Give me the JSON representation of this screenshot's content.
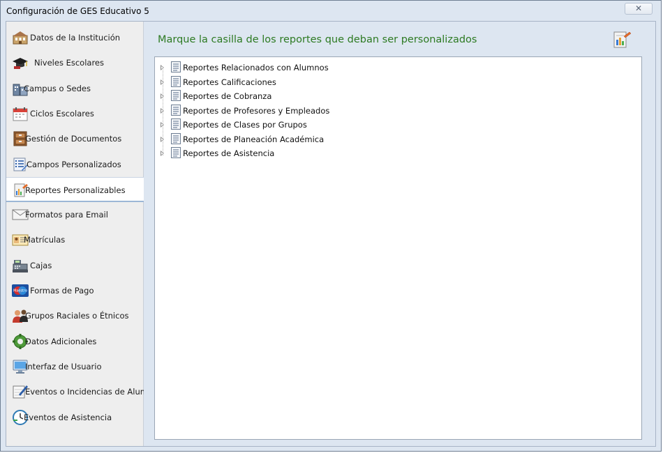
{
  "window": {
    "title": "Configuración de GES Educativo 5",
    "close_symbol": "✕"
  },
  "sidebar": {
    "items": [
      {
        "label": "Datos de la Institución",
        "icon": "building-icon"
      },
      {
        "label": "Niveles Escolares",
        "icon": "graduation-cap-icon"
      },
      {
        "label": "Campus o Sedes",
        "icon": "buildings-icon"
      },
      {
        "label": "Ciclos Escolares",
        "icon": "calendar-icon"
      },
      {
        "label": "Gestión de Documentos",
        "icon": "file-cabinet-icon"
      },
      {
        "label": "Campos Personalizados",
        "icon": "checklist-icon"
      },
      {
        "label": "Reportes Personalizables",
        "icon": "report-edit-icon",
        "selected": true
      },
      {
        "label": "Formatos para Email",
        "icon": "envelope-icon"
      },
      {
        "label": "Matrículas",
        "icon": "id-card-icon"
      },
      {
        "label": "Cajas",
        "icon": "cash-register-icon"
      },
      {
        "label": "Formas de Pago",
        "icon": "payment-card-icon",
        "icon_text": "Maestro"
      },
      {
        "label": "Grupos Raciales o Étnicos",
        "icon": "people-icon"
      },
      {
        "label": "Datos Adicionales",
        "icon": "gear-icon"
      },
      {
        "label": "Interfaz de Usuario",
        "icon": "monitor-icon"
      },
      {
        "label": "Eventos o Incidencias de Alumnos",
        "icon": "notebook-pen-icon"
      },
      {
        "label": "Eventos de Asistencia",
        "icon": "clock-icon"
      }
    ]
  },
  "main": {
    "heading": "Marque la casilla de los reportes que deban ser personalizados",
    "heading_color": "#2d7a22",
    "tree": [
      {
        "label": "Reportes Relacionados con Alumnos"
      },
      {
        "label": "Reportes Calificaciones"
      },
      {
        "label": "Reportes de Cobranza"
      },
      {
        "label": "Reportes de Profesores y Empleados"
      },
      {
        "label": "Reportes de Clases por Grupos"
      },
      {
        "label": "Reportes de Planeación Académica"
      },
      {
        "label": "Reportes de Asistencia"
      }
    ]
  }
}
